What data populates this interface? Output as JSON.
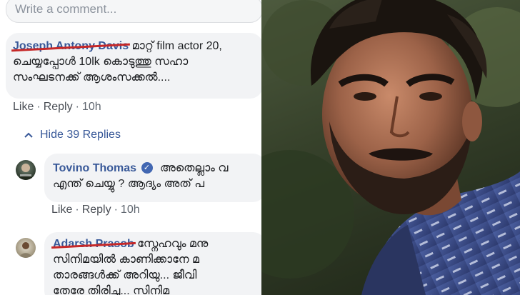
{
  "comment_box": {
    "placeholder": "Write a comment..."
  },
  "comment1": {
    "author": "Joseph Antony Davis",
    "line1": "മാറ്റ് film actor 20,",
    "line2": "ചെയ്യപ്പോൾ 10lk കൊടുത്തു സഹാ",
    "line3": "സംഘടനക്ക് ആശംസക്കൽ....",
    "like": "Like",
    "reply": "Reply",
    "time": "10h"
  },
  "hide_replies": "Hide 39 Replies",
  "reply1": {
    "author": "Tovino Thomas",
    "line1": "അതെല്ലാം വ",
    "line2": "എന്ത് ചെയ്യു ? ആദ്യം അത് പ",
    "like": "Like",
    "reply": "Reply",
    "time": "10h"
  },
  "reply2": {
    "author": "Adarsh Prasob",
    "line1": "സ്നേഹവും മനു",
    "line2": "സിനിമയിൽ കാണിക്കാനേ മ",
    "line3": "താരങ്ങൾക്ക് അറിയു... ജീവി",
    "line4": "തേരേ തിരിച്ചു... സിനിമ"
  },
  "colors": {
    "link": "#385898",
    "bubble": "#f2f3f5",
    "meta": "#606770",
    "verified": "#4267b2",
    "redaction": "#c62828"
  },
  "icons": {
    "verified": "verified-badge-icon",
    "collapse": "chevron-up-icon"
  }
}
